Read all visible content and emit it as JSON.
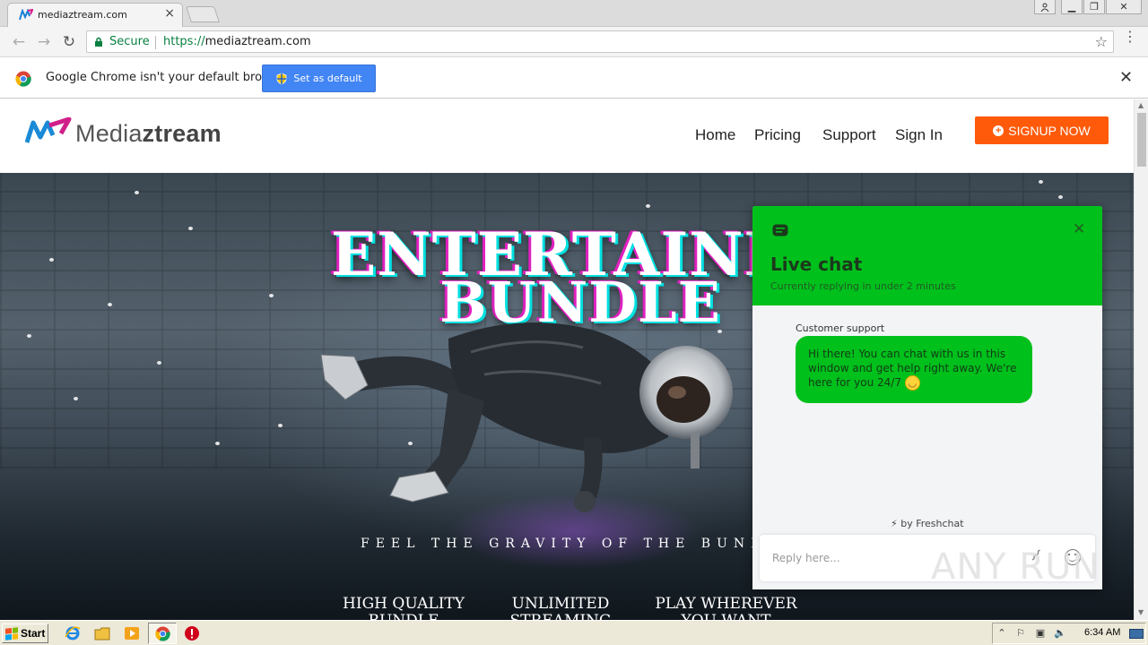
{
  "browser": {
    "tab_title": "mediaztream.com",
    "secure_label": "Secure",
    "url_scheme": "https://",
    "url_host": "mediaztream.com",
    "infobar_text": "Google Chrome isn't your default browser",
    "set_default_label": "Set as default"
  },
  "site": {
    "logo_light": "Media",
    "logo_bold": "ztream",
    "nav": [
      "Home",
      "Pricing",
      "Support",
      "Sign In"
    ],
    "signup_label": "SIGNUP NOW",
    "accent_color": "#ff5a0a"
  },
  "hero": {
    "title_line1": "ENTERTAINME",
    "title_line2": "BUNDLE",
    "tagline": "FEEL THE GRAVITY OF THE BUNDL",
    "features": [
      {
        "line1": "HIGH QUALITY",
        "line2": "BUNDLE STREAM"
      },
      {
        "line1": "UNLIMITED",
        "line2": "STREAMING"
      },
      {
        "line1": "PLAY WHEREVER",
        "line2": "YOU WANT"
      }
    ]
  },
  "chat": {
    "title": "Live chat",
    "subtitle": "Currently replying in under 2 minutes",
    "agent_name": "Customer support",
    "message": "Hi there! You can chat with us in this window and get help right away. We're here for you 24/7",
    "powered_by": "⚡ by Freshchat",
    "reply_placeholder": "Reply here...",
    "header_color": "#00c01c"
  },
  "watermark": "ANY RUN",
  "taskbar": {
    "start_label": "Start",
    "clock": "6:34 AM"
  }
}
